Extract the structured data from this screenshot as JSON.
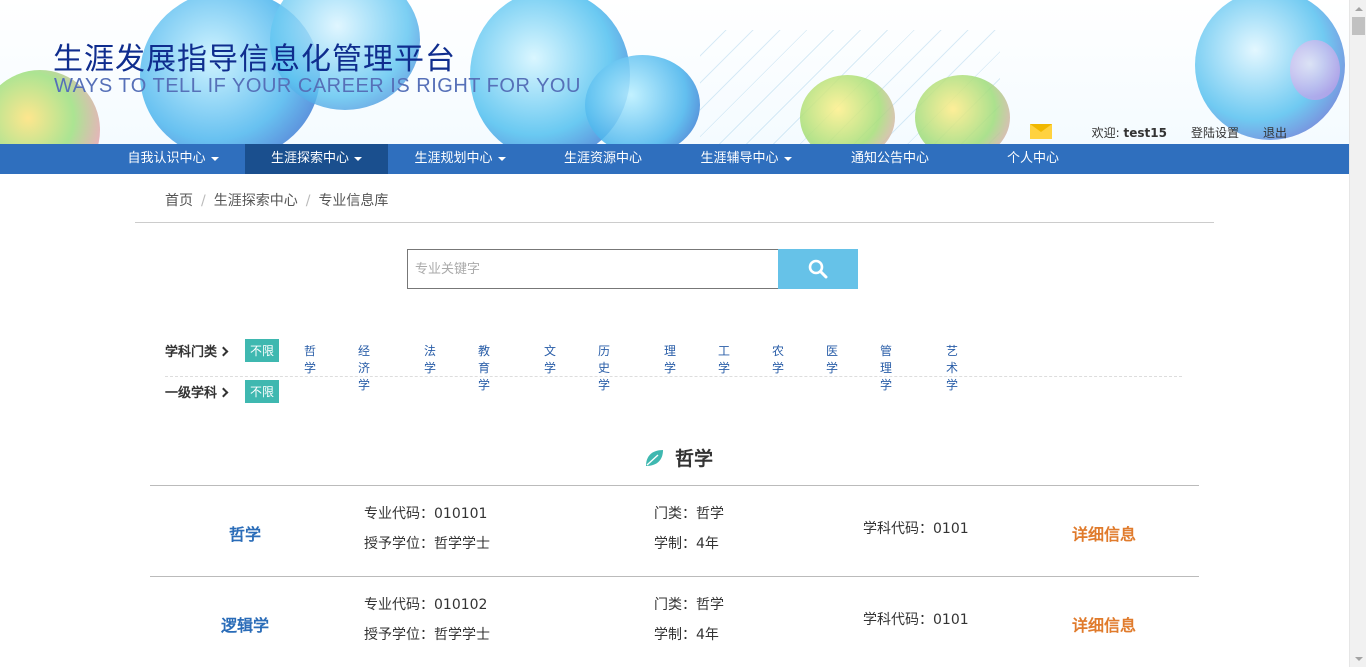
{
  "header": {
    "title": "生涯发展指导信息化管理平台",
    "subtitle": "WAYS TO TELL IF YOUR CAREER IS RIGHT FOR YOU",
    "welcome_prefix": "欢迎: ",
    "username": "test15",
    "login_settings": "登陆设置",
    "logout": "退出"
  },
  "nav": {
    "items": [
      {
        "label": "自我认识中心",
        "dropdown": true
      },
      {
        "label": "生涯探索中心",
        "dropdown": true,
        "active": true
      },
      {
        "label": "生涯规划中心",
        "dropdown": true
      },
      {
        "label": "生涯资源中心",
        "dropdown": false
      },
      {
        "label": "生涯辅导中心",
        "dropdown": true
      },
      {
        "label": "通知公告中心",
        "dropdown": false
      },
      {
        "label": "个人中心",
        "dropdown": false
      }
    ]
  },
  "breadcrumb": [
    "首页",
    "生涯探索中心",
    "专业信息库"
  ],
  "search": {
    "placeholder": "专业关键字",
    "value": ""
  },
  "filters": {
    "category_label": "学科门类",
    "category_selected": "不限",
    "categories": [
      "哲学",
      "经济学",
      "法学",
      "教育学",
      "文学",
      "历史学",
      "理学",
      "工学",
      "农学",
      "医学",
      "管理学",
      "艺术学"
    ],
    "subject_label": "一级学科",
    "subject_selected": "不限"
  },
  "section": {
    "title": "哲学"
  },
  "majors": [
    {
      "name": "哲学",
      "code_label": "专业代码：010101",
      "degree_label": "授予学位：哲学学士",
      "category_label": "门类：哲学",
      "duration_label": "学制：4年",
      "subject_code_label": "学科代码：0101",
      "detail": "详细信息"
    },
    {
      "name": "逻辑学",
      "code_label": "专业代码：010102",
      "degree_label": "授予学位：哲学学士",
      "category_label": "门类：哲学",
      "duration_label": "学制：4年",
      "subject_code_label": "学科代码：0101",
      "detail": "详细信息"
    }
  ],
  "colors": {
    "nav_bg": "#2f6fbe",
    "nav_active": "#1a4f8e",
    "tag_active": "#3fb8b0",
    "search_button": "#66c2e8",
    "major_name": "#2a6cb8",
    "detail_link": "#e07b2c",
    "title": "#0f2d8e"
  }
}
